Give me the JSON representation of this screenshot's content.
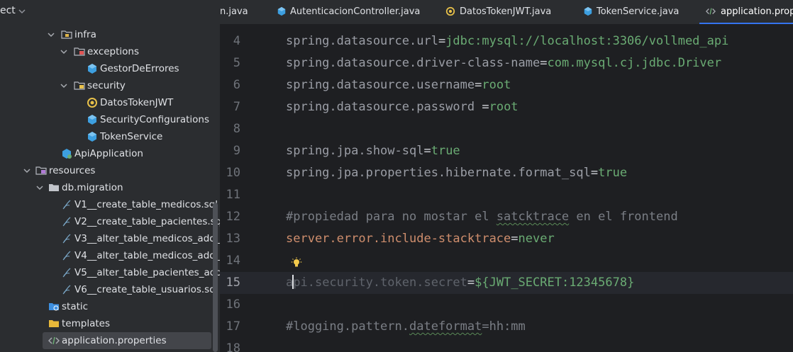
{
  "project": {
    "title": "ect",
    "tree": [
      {
        "label": "infra",
        "icon": "package-folder-icon"
      },
      {
        "label": "exceptions",
        "icon": "folder-red-icon"
      },
      {
        "label": "GestorDeErrores",
        "icon": "class-icon"
      },
      {
        "label": "security",
        "icon": "folder-lock-icon"
      },
      {
        "label": "DatosTokenJWT",
        "icon": "record-icon"
      },
      {
        "label": "SecurityConfigurations",
        "icon": "class-icon"
      },
      {
        "label": "TokenService",
        "icon": "class-icon"
      },
      {
        "label": "ApiApplication",
        "icon": "spring-app-icon"
      },
      {
        "label": "resources",
        "icon": "resources-folder-icon"
      },
      {
        "label": "db.migration",
        "icon": "folder-icon"
      },
      {
        "label": "V1__create_table_medicos.sql",
        "icon": "sql-file-icon"
      },
      {
        "label": "V2__create_table_pacientes.sql",
        "icon": "sql-file-icon"
      },
      {
        "label": "V3__alter_table_medicos_add_col",
        "icon": "sql-file-icon"
      },
      {
        "label": "V4__alter_table_medicos_add_col",
        "icon": "sql-file-icon"
      },
      {
        "label": "V5__alter_table_pacientes_add_co",
        "icon": "sql-file-icon"
      },
      {
        "label": "V6__create_table_usuarios.sql",
        "icon": "sql-file-icon"
      },
      {
        "label": "static",
        "icon": "web-folder-icon"
      },
      {
        "label": "templates",
        "icon": "folder-yellow-icon"
      },
      {
        "label": "application.properties",
        "icon": "properties-file-icon"
      }
    ]
  },
  "tabs": [
    {
      "label": "n.java",
      "icon": "java-icon"
    },
    {
      "label": "AutenticacionController.java",
      "icon": "class-icon"
    },
    {
      "label": "DatosTokenJWT.java",
      "icon": "record-icon"
    },
    {
      "label": "TokenService.java",
      "icon": "class-icon"
    },
    {
      "label": "application.prop",
      "icon": "properties-file-icon"
    }
  ],
  "editor": {
    "lines": [
      {
        "n": "4",
        "key": "spring.datasource.url",
        "sep": "=",
        "val": "jdbc:mysql://localhost:3306/vollmed_api"
      },
      {
        "n": "5",
        "key": "spring.datasource.driver-class-name",
        "sep": "=",
        "val": "com.mysql.cj.jdbc.Driver"
      },
      {
        "n": "6",
        "key": "spring.datasource.username",
        "sep": "=",
        "val": "root"
      },
      {
        "n": "7",
        "key": "spring.datasource.password ",
        "sep": "=",
        "val": "root"
      },
      {
        "n": "8"
      },
      {
        "n": "9",
        "key": "spring.jpa.show-sql",
        "sep": "=",
        "val": "true"
      },
      {
        "n": "10",
        "key": "spring.jpa.properties.hibernate.format_sql",
        "sep": "=",
        "val": "true"
      },
      {
        "n": "11"
      },
      {
        "n": "12",
        "comment_a": "#propiedad para no mostar el ",
        "comment_sq": "satcktrace",
        "comment_b": " en el frontend"
      },
      {
        "n": "13",
        "key": "server.error.include-stacktrace",
        "sep": "=",
        "val": "never"
      },
      {
        "n": "14"
      },
      {
        "n": "15",
        "key_a": "a",
        "key_b": "pi.security.token.secret",
        "sep": "=",
        "val": "${JWT_SECRET:12345678}"
      },
      {
        "n": "16"
      },
      {
        "n": "17",
        "comment_a": "#logging.pattern.",
        "comment_sq": "dateformat",
        "comment_b": "=hh:mm"
      },
      {
        "n": "18"
      }
    ]
  },
  "colors": {
    "accent": "#3574f0",
    "string_value": "#6aab73",
    "key_highlight": "#cf8e6d"
  }
}
